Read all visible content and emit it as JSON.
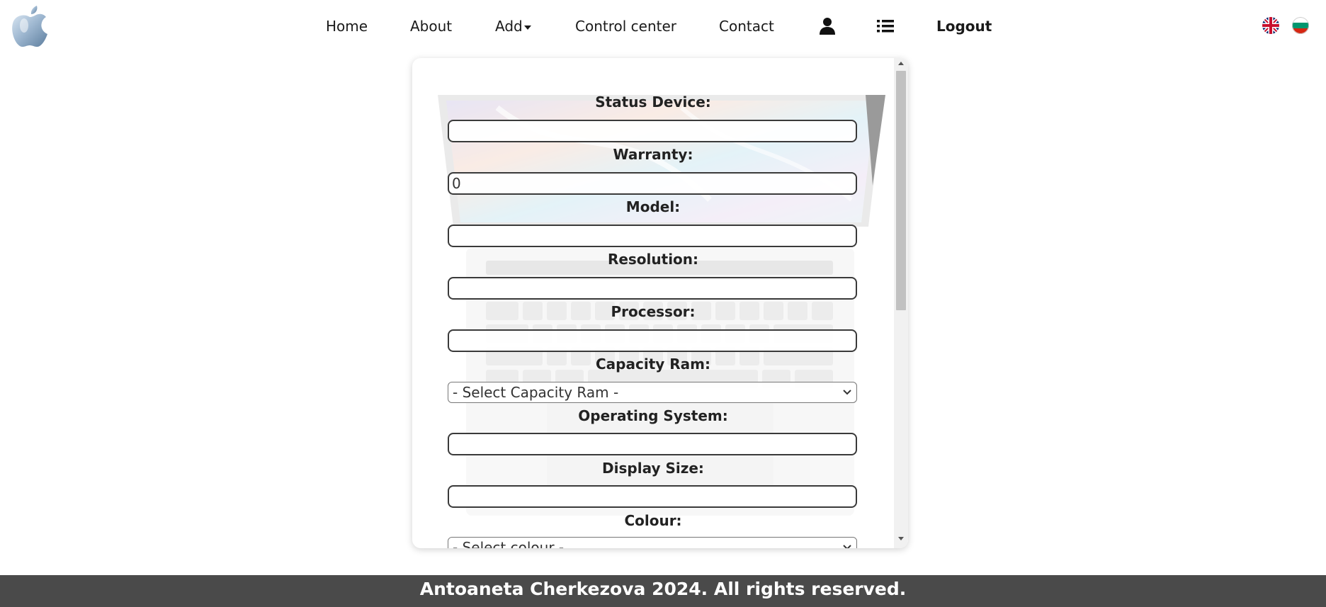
{
  "nav": {
    "logo_icon": "apple-icon",
    "items": [
      "Home",
      "About",
      "Add",
      "Control center",
      "Contact"
    ],
    "add_caret": "caret-down-icon",
    "profile_icon": "user-icon",
    "list_icon": "list-icon",
    "logout": "Logout",
    "languages": [
      "uk-flag-icon",
      "bulgaria-flag-icon"
    ]
  },
  "form": {
    "status_device": {
      "label": "Status Device:",
      "value": ""
    },
    "warranty": {
      "label": "Warranty:",
      "value": "0"
    },
    "model": {
      "label": "Model:",
      "value": ""
    },
    "resolution": {
      "label": "Resolution:",
      "value": ""
    },
    "processor": {
      "label": "Processor:",
      "value": ""
    },
    "capacity_ram": {
      "label": "Capacity Ram:",
      "selected": "- Select Capacity Ram -"
    },
    "operating_system": {
      "label": "Operating System:",
      "value": ""
    },
    "display_size": {
      "label": "Display Size:",
      "value": ""
    },
    "colour": {
      "label": "Colour:",
      "selected": "- Select colour -"
    }
  },
  "footer": {
    "text": "Antoaneta Cherkezova 2024. All rights reserved."
  }
}
